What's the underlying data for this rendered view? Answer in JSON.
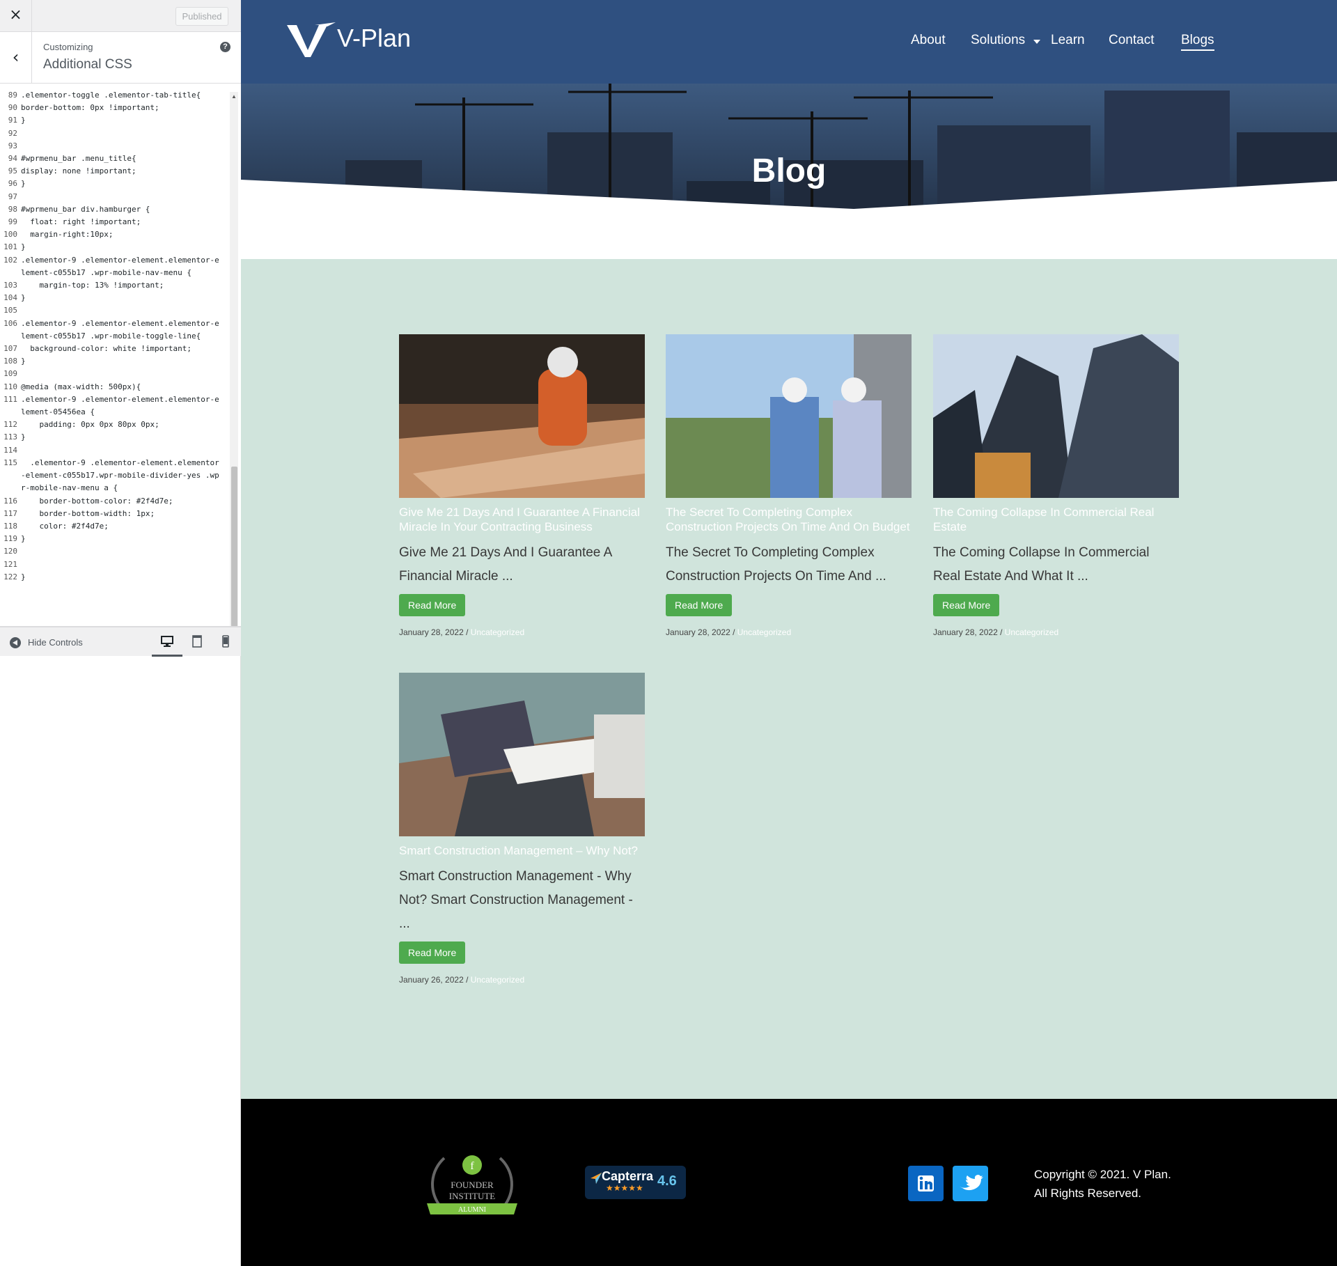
{
  "customizer": {
    "close_icon": "×",
    "publish_label": "Published",
    "back_icon": "‹",
    "breadcrumb": "Customizing",
    "section_title": "Additional CSS",
    "help_icon": "?",
    "hide_controls_label": "Hide Controls",
    "devices": [
      "desktop",
      "tablet",
      "mobile"
    ],
    "code_lines": [
      {
        "n": "89",
        "t": ".elementor-toggle .elementor-tab-title{"
      },
      {
        "n": "90",
        "t": "border-bottom: 0px !important;"
      },
      {
        "n": "91",
        "t": "}"
      },
      {
        "n": "92",
        "t": ""
      },
      {
        "n": "93",
        "t": ""
      },
      {
        "n": "94",
        "t": "#wprmenu_bar .menu_title{"
      },
      {
        "n": "95",
        "t": "display: none !important;"
      },
      {
        "n": "96",
        "t": "}"
      },
      {
        "n": "97",
        "t": ""
      },
      {
        "n": "98",
        "t": "#wprmenu_bar div.hamburger {"
      },
      {
        "n": "99",
        "t": "  float: right !important;"
      },
      {
        "n": "100",
        "t": "  margin-right:10px;"
      },
      {
        "n": "101",
        "t": "}"
      },
      {
        "n": "102",
        "t": ".elementor-9 .elementor-element.elementor-element-c055b17 .wpr-mobile-nav-menu {"
      },
      {
        "n": "103",
        "t": "    margin-top: 13% !important;"
      },
      {
        "n": "104",
        "t": "}"
      },
      {
        "n": "105",
        "t": ""
      },
      {
        "n": "106",
        "t": ".elementor-9 .elementor-element.elementor-element-c055b17 .wpr-mobile-toggle-line{"
      },
      {
        "n": "107",
        "t": "  background-color: white !important;"
      },
      {
        "n": "108",
        "t": "}"
      },
      {
        "n": "109",
        "t": ""
      },
      {
        "n": "110",
        "t": "@media (max-width: 500px){"
      },
      {
        "n": "111",
        "t": ".elementor-9 .elementor-element.elementor-element-05456ea {"
      },
      {
        "n": "112",
        "t": "    padding: 0px 0px 80px 0px;"
      },
      {
        "n": "113",
        "t": "}"
      },
      {
        "n": "114",
        "t": ""
      },
      {
        "n": "115",
        "t": "  .elementor-9 .elementor-element.elementor-element-c055b17.wpr-mobile-divider-yes .wpr-mobile-nav-menu a {"
      },
      {
        "n": "116",
        "t": "    border-bottom-color: #2f4d7e;"
      },
      {
        "n": "117",
        "t": "    border-bottom-width: 1px;"
      },
      {
        "n": "118",
        "t": "    color: #2f4d7e;"
      },
      {
        "n": "119",
        "t": "}"
      },
      {
        "n": "120",
        "t": ""
      },
      {
        "n": "121",
        "t": ""
      },
      {
        "n": "122",
        "t": "}"
      }
    ]
  },
  "site": {
    "logo_text": "V-Plan",
    "nav": {
      "about": "About",
      "solutions": "Solutions",
      "learn": "Learn",
      "contact": "Contact",
      "blogs": "Blogs"
    },
    "hero_title": "Blog",
    "posts": [
      {
        "overlay_title": "Give Me 21 Days And I Guarantee A Financial Miracle In Your Contracting Business",
        "title": "Give Me 21 Days And I Guarantee A Financial Miracle ...",
        "button": "Read More",
        "date": "January 28, 2022",
        "sep": " / ",
        "category": "Uncategorized",
        "image": "construction-worker-photo"
      },
      {
        "overlay_title": "The Secret To Completing Complex Construction Projects On Time And On Budget",
        "title": "The Secret To Completing Complex Construction Projects On Time And ...",
        "button": "Read More",
        "date": "January 28, 2022",
        "sep": " / ",
        "category": "Uncategorized",
        "image": "engineers-tablet-photo"
      },
      {
        "overlay_title": "The Coming Collapse In Commercial Real Estate",
        "title": "The Coming Collapse In Commercial Real Estate And What It ...",
        "button": "Read More",
        "date": "January 28, 2022",
        "sep": " / ",
        "category": "Uncategorized",
        "image": "skyscrapers-photo"
      },
      {
        "overlay_title": "Smart Construction Management – Why Not?",
        "title": "Smart Construction Management - Why Not? Smart Construction Management - ...",
        "button": "Read More",
        "date": "January 26, 2022",
        "sep": " / ",
        "category": "Uncategorized",
        "image": "laptop-plans-photo"
      }
    ],
    "footer": {
      "founder_badge": {
        "line1": "FOUNDER",
        "line2": "INSTITUTE",
        "ribbon": "ALUMNI"
      },
      "capterra": {
        "name": "Capterra",
        "rating": "4.6",
        "stars": "★★★★★"
      },
      "social": [
        "linkedin-icon",
        "twitter-icon"
      ],
      "copyright_line1": "Copyright © 2021. V Plan.",
      "copyright_line2": "All Rights Reserved."
    },
    "colors": {
      "header": "#2f5080",
      "blog_bg": "#d0e4dc",
      "button": "#4eaa4e",
      "footer": "#000000"
    }
  }
}
